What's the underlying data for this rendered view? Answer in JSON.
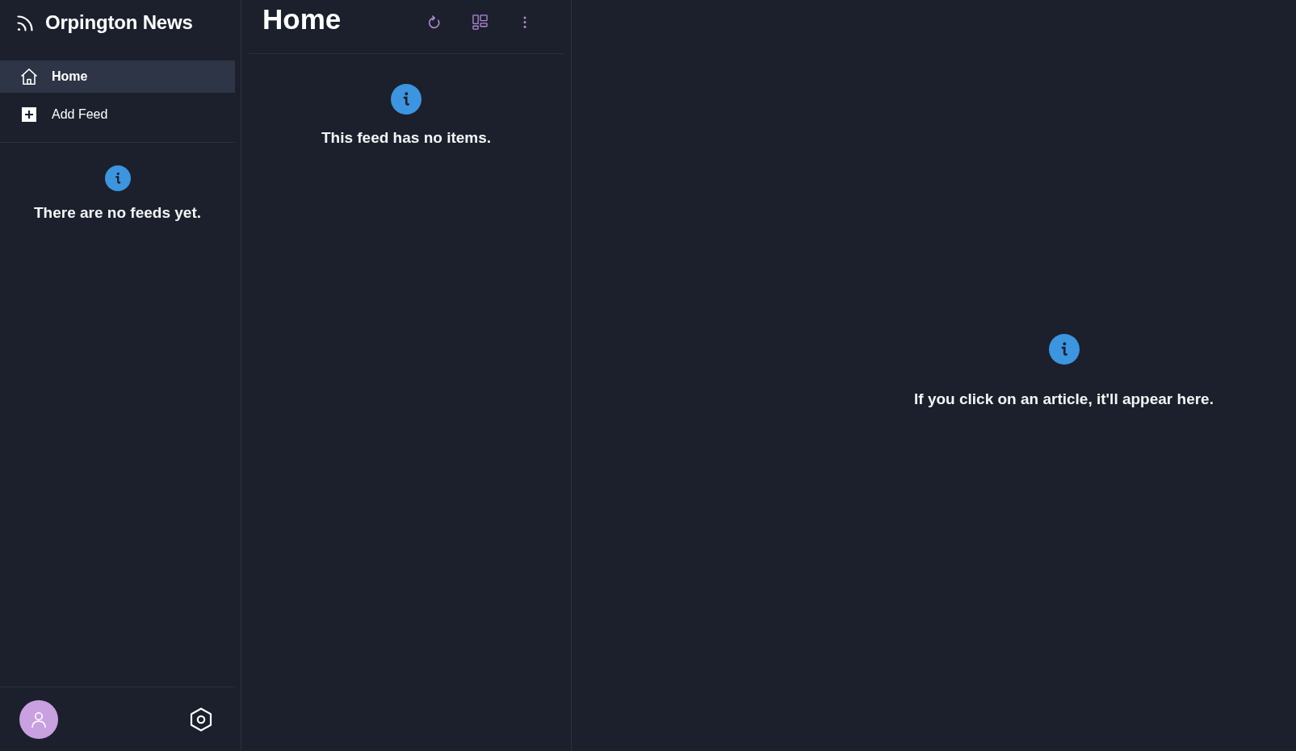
{
  "sidebar": {
    "app_title": "Orpington News",
    "nav_items": [
      {
        "kind": "home",
        "label": "Home",
        "selected": true
      },
      {
        "kind": "add",
        "label": "Add Feed",
        "selected": false
      }
    ],
    "empty_message": "There are no feeds yet."
  },
  "feed": {
    "title": "Home",
    "empty_message": "This feed has no items."
  },
  "article": {
    "empty_message": "If you click on an article, it'll appear here."
  }
}
